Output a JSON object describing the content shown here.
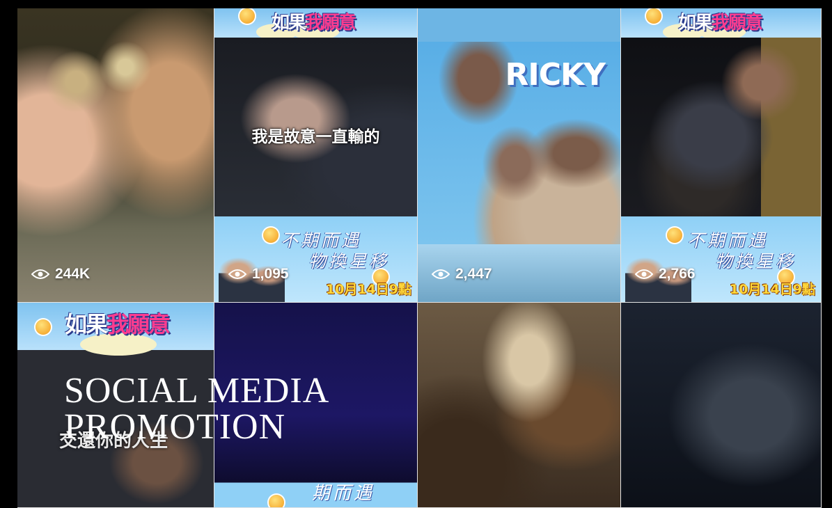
{
  "title": {
    "line1": "SOCIAL MEDIA",
    "line2": "PROMOTION"
  },
  "tiles": [
    {
      "views": "244K"
    },
    {
      "views": "1,095",
      "caption": "我是故意一直輸的",
      "logo_a": "如果",
      "logo_b": "我願意",
      "promo_title_1": "不期而遇",
      "promo_title_2": "物換星移",
      "promo_date": "10月14日9點"
    },
    {
      "views": "2,447",
      "ricky": "RICKY"
    },
    {
      "views": "2,766",
      "logo_a": "如果",
      "logo_b": "我願意",
      "promo_title_1": "不期而遇",
      "promo_title_2": "物換星移",
      "promo_date": "10月14日9點"
    }
  ],
  "bottom": {
    "logo_a": "如果",
    "logo_b": "我願意",
    "subtitle": "交還你的人生",
    "promo_title": "期而遇"
  },
  "icons": [
    "eye-icon"
  ],
  "colors": {
    "banner": "#7ec6ef",
    "date": "#ffd83a",
    "logo_pink": "#ff3c8f"
  }
}
